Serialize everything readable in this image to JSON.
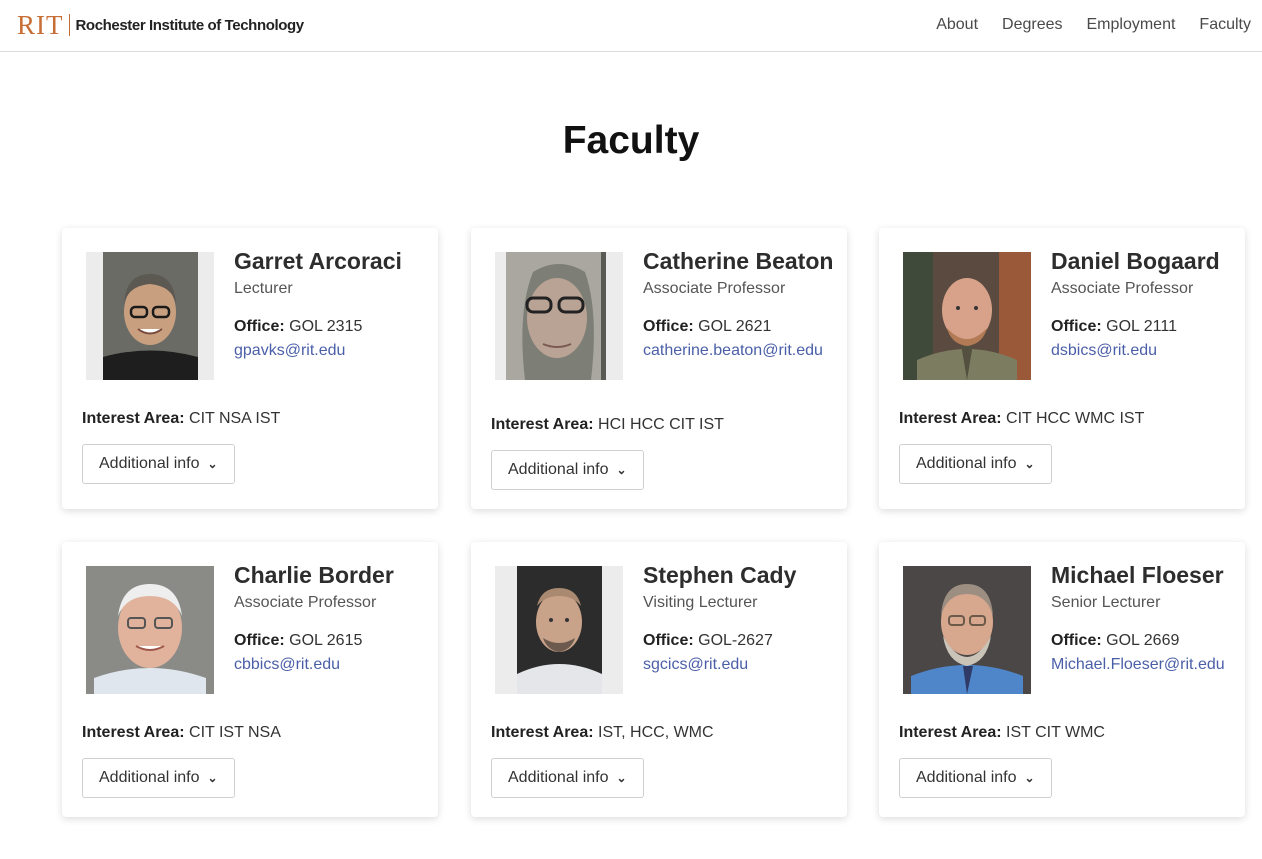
{
  "brand": {
    "mark": "RIT",
    "name": "Rochester Institute of Technology",
    "accent": "#c76e36"
  },
  "nav": [
    "About",
    "Degrees",
    "Employment",
    "Faculty"
  ],
  "page_title": "Faculty",
  "labels": {
    "office": "Office:",
    "interest": "Interest Area:",
    "more": "Additional info"
  },
  "faculty": [
    {
      "name": "Garret Arcoraci",
      "title": "Lecturer",
      "office": "GOL 2315",
      "email": "gpavks@rit.edu",
      "interest": "CIT NSA IST"
    },
    {
      "name": "Catherine Beaton",
      "title": "Associate Professor",
      "office": "GOL 2621",
      "email": "catherine.beaton@rit.edu",
      "interest": "HCI HCC CIT IST"
    },
    {
      "name": "Daniel Bogaard",
      "title": "Associate Professor",
      "office": "GOL 2111",
      "email": "dsbics@rit.edu",
      "interest": "CIT HCC WMC IST"
    },
    {
      "name": "Charlie Border",
      "title": "Associate Professor",
      "office": "GOL 2615",
      "email": "cbbics@rit.edu",
      "interest": "CIT IST NSA"
    },
    {
      "name": "Stephen Cady",
      "title": "Visiting Lecturer",
      "office": "GOL-2627",
      "email": "sgcics@rit.edu",
      "interest": "IST, HCC, WMC"
    },
    {
      "name": "Michael Floeser",
      "title": "Senior Lecturer",
      "office": "GOL 2669",
      "email": "Michael.Floeser@rit.edu",
      "interest": "IST CIT WMC"
    }
  ]
}
